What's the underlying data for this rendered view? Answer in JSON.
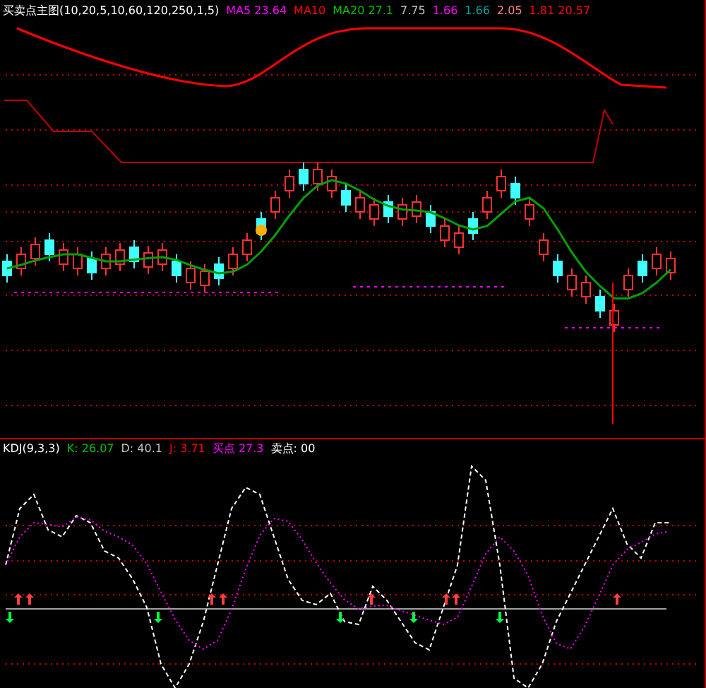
{
  "main_panel": {
    "legend": [
      {
        "text": "买卖点主图(10,20,5,10,60,120,250,1,5)",
        "color": "#ffffff"
      },
      {
        "text": "MA5 23.64",
        "color": "#ff00ff"
      },
      {
        "text": "MA10",
        "color": "#ff0000"
      },
      {
        "text": "MA20 27.1",
        "color": "#00c000"
      },
      {
        "text": "7.75",
        "color": "#c0c0c0"
      },
      {
        "text": "1.66",
        "color": "#ff00ff"
      },
      {
        "text": "1.66",
        "color": "#00a0a0"
      },
      {
        "text": "2.05",
        "color": "#ff8080"
      },
      {
        "text": "1.81 20.57",
        "color": "#ff0000"
      }
    ]
  },
  "sub_panel": {
    "legend": [
      {
        "text": "KDJ(9,3,3)",
        "color": "#ffffff"
      },
      {
        "text": "K: 26.07",
        "color": "#00c000"
      },
      {
        "text": "D: 40.1",
        "color": "#c0c0c0"
      },
      {
        "text": "J: 3.71",
        "color": "#ff0000"
      },
      {
        "text": "买点 27.3",
        "color": "#ff00ff"
      },
      {
        "text": "卖点: 00",
        "color": "#ffffff"
      }
    ]
  }
}
